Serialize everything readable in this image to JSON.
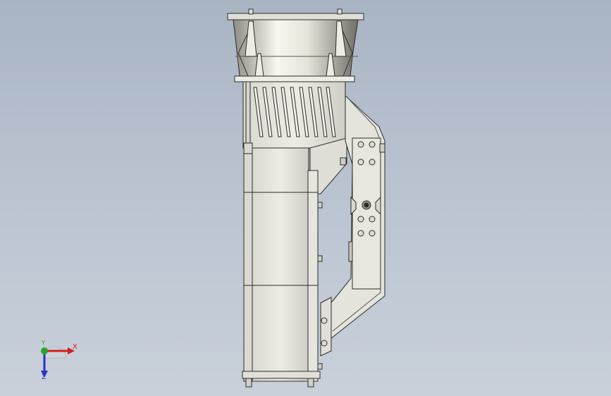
{
  "viewport": {
    "background_top": "#a9b4c3",
    "background_bottom": "#c9d0da"
  },
  "model": {
    "part_fill": "#e6e6e0",
    "part_shade": "#cfcfc7",
    "edge_color": "#2b2b2b",
    "hopper_highlight": "#f7f7ef",
    "hopper_shadow": "#8c8c84"
  },
  "triad": {
    "x_label": "X",
    "y_label": "Y",
    "z_label": "Z",
    "x_color": "#d21f1f",
    "y_color": "#2aa52a",
    "z_color": "#2436c9"
  }
}
